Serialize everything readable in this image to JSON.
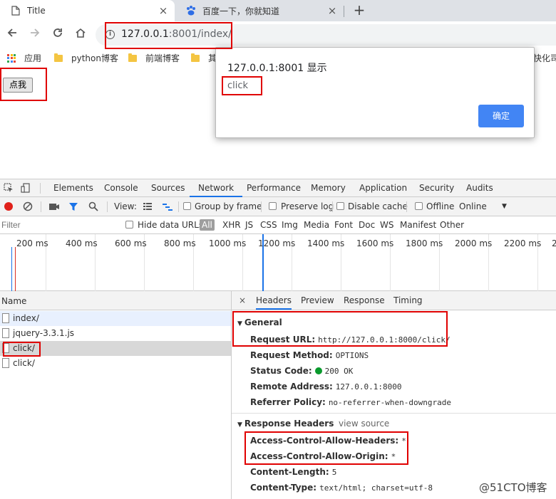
{
  "browser": {
    "tabs": [
      {
        "title": "Title",
        "active": true
      },
      {
        "title": "百度一下，你就知道",
        "active": false
      }
    ],
    "new_tab_symbol": "+",
    "close_symbol": "×",
    "url_host": "127.0.0.1",
    "url_rest": ":8001/index/",
    "nav_icons": [
      "back-arrow-icon",
      "forward-arrow-icon",
      "reload-icon",
      "home-icon"
    ],
    "bookmarks": [
      {
        "label": "应用",
        "icon": "apps-grid-icon"
      },
      {
        "label": "python博客",
        "icon": "folder-icon"
      },
      {
        "label": "前端博客",
        "icon": "folder-icon"
      },
      {
        "label": "其",
        "icon": "folder-icon"
      },
      {
        "label": "快化司",
        "icon": ""
      }
    ]
  },
  "page": {
    "button_label": "点我"
  },
  "alert": {
    "title": "127.0.0.1:8001 显示",
    "message": "click",
    "ok_label": "确定",
    "ok_color": "#4285f4"
  },
  "devtools": {
    "tabs": [
      "Elements",
      "Console",
      "Sources",
      "Network",
      "Performance",
      "Memory",
      "Application",
      "Security",
      "Audits"
    ],
    "active_tab": "Network",
    "toolbar": {
      "view_label": "View:",
      "group_by_frame": "Group by frame",
      "preserve_log": "Preserve log",
      "disable_cache": "Disable cache",
      "offline": "Offline",
      "online": "Online"
    },
    "filter": {
      "placeholder": "Filter",
      "hide_data_urls": "Hide data URLs",
      "types": [
        "All",
        "XHR",
        "JS",
        "CSS",
        "Img",
        "Media",
        "Font",
        "Doc",
        "WS",
        "Manifest",
        "Other"
      ]
    },
    "timeline_ticks": [
      "200 ms",
      "400 ms",
      "600 ms",
      "800 ms",
      "1000 ms",
      "1200 ms",
      "1400 ms",
      "1600 ms",
      "1800 ms",
      "2000 ms",
      "2200 ms",
      "2"
    ],
    "requests": {
      "header": "Name",
      "items": [
        "index/",
        "jquery-3.3.1.js",
        "click/",
        "click/"
      ]
    },
    "detail_tabs": [
      "Headers",
      "Preview",
      "Response",
      "Timing"
    ],
    "close_symbol": "×",
    "general": {
      "title": "General",
      "rows": [
        {
          "k": "Request URL:",
          "v": "http://127.0.0.1:8000/click/"
        },
        {
          "k": "Request Method:",
          "v": "OPTIONS"
        },
        {
          "k": "Status Code:",
          "v": "200 OK"
        },
        {
          "k": "Remote Address:",
          "v": "127.0.0.1:8000"
        },
        {
          "k": "Referrer Policy:",
          "v": "no-referrer-when-downgrade"
        }
      ]
    },
    "response_headers": {
      "title": "Response Headers",
      "view_source": "view source",
      "rows": [
        {
          "k": "Access-Control-Allow-Headers:",
          "v": "*"
        },
        {
          "k": "Access-Control-Allow-Origin:",
          "v": "*"
        },
        {
          "k": "Content-Length:",
          "v": "5"
        },
        {
          "k": "Content-Type:",
          "v": "text/html; charset=utf-8"
        }
      ]
    }
  },
  "watermark": "@51CTO博客",
  "colors": {
    "accent": "#1a73e8",
    "annotation": "#e00000",
    "status_ok": "#0a9a2d"
  }
}
